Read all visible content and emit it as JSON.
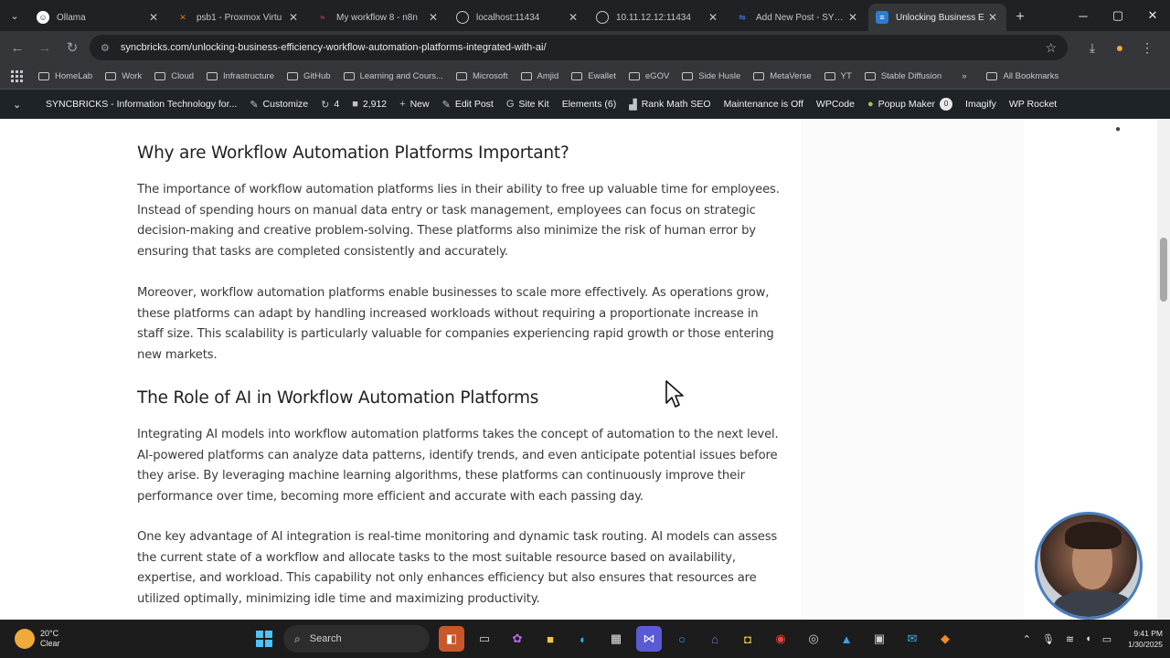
{
  "browser": {
    "tabs": [
      {
        "label": "Ollama",
        "icon": "ollama-icon",
        "active": false,
        "color": "#ffffff"
      },
      {
        "label": "psb1 - Proxmox Virtu",
        "icon": "proxmox-icon",
        "active": false,
        "color": "#e57000"
      },
      {
        "label": "My workflow 8 - n8n",
        "icon": "n8n-icon",
        "active": false,
        "color": "#ea4b71"
      },
      {
        "label": "localhost:11434",
        "icon": "globe-icon",
        "active": false,
        "color": "#9aa0a6"
      },
      {
        "label": "10.11.12.12:11434",
        "icon": "globe-icon",
        "active": false,
        "color": "#9aa0a6"
      },
      {
        "label": "Add New Post - SYNC",
        "icon": "wordpress-icon",
        "active": false,
        "color": "#3b82f6"
      },
      {
        "label": "Unlocking Business E",
        "icon": "syncbricks-icon",
        "active": true,
        "color": "#2d7bd4"
      }
    ],
    "url": "syncbricks.com/unlocking-business-efficiency-workflow-automation-platforms-integrated-with-ai/",
    "bookmarks": [
      "HomeLab",
      "Work",
      "Cloud",
      "Infrastructure",
      "GitHub",
      "Learning and Cours...",
      "Microsoft",
      "Amjid",
      "Ewallet",
      "eGOV",
      "Side Husle",
      "MetaVerse",
      "YT",
      "Stable Diffusion"
    ],
    "all_bookmarks_label": "All Bookmarks"
  },
  "adminbar": {
    "site_name": "SYNCBRICKS - Information Technology for...",
    "customize": "Customize",
    "updates": "4",
    "comments": "2,912",
    "new": "New",
    "edit_post": "Edit Post",
    "site_kit": "Site Kit",
    "elements": "Elements (6)",
    "rank_math": "Rank Math SEO",
    "maintenance": "Maintenance is Off",
    "wpcode": "WPCode",
    "popup_maker": "Popup Maker",
    "popup_badge": "0",
    "imagify": "Imagify",
    "wp_rocket": "WP Rocket"
  },
  "article": {
    "heading1": "Why are Workflow Automation Platforms Important?",
    "para1": "The importance of workflow automation platforms lies in their ability to free up valuable time for employees. Instead of spending hours on manual data entry or task management, employees can focus on strategic decision-making and creative problem-solving. These platforms also minimize the risk of human error by ensuring that tasks are completed consistently and accurately.",
    "para2": "Moreover, workflow automation platforms enable businesses to scale more effectively. As operations grow, these platforms can adapt by handling increased workloads without requiring a proportionate increase in staff size. This scalability is particularly valuable for companies experiencing rapid growth or those entering new markets.",
    "heading2": "The Role of AI in Workflow Automation Platforms",
    "para3": "Integrating AI models into workflow automation platforms takes the concept of automation to the next level. AI-powered platforms can analyze data patterns, identify trends, and even anticipate potential issues before they arise. By leveraging machine learning algorithms, these platforms can continuously improve their performance over time, becoming more efficient and accurate with each passing day.",
    "para4": "One key advantage of AI integration is real-time monitoring and dynamic task routing. AI models can assess the current state of a workflow and allocate tasks to the most suitable resource based on availability, expertise, and workload. This capability not only enhances efficiency but also ensures that resources are utilized optimally, minimizing idle time and maximizing productivity."
  },
  "taskbar": {
    "temperature": "20°C",
    "weather": "Clear",
    "search_placeholder": "Search",
    "time": "9:41 PM",
    "date": "1/30/2025"
  },
  "colors": {
    "accent": "#4cc2ff",
    "adminbar_bg": "#1d2327",
    "chrome_dark": "#202124"
  }
}
